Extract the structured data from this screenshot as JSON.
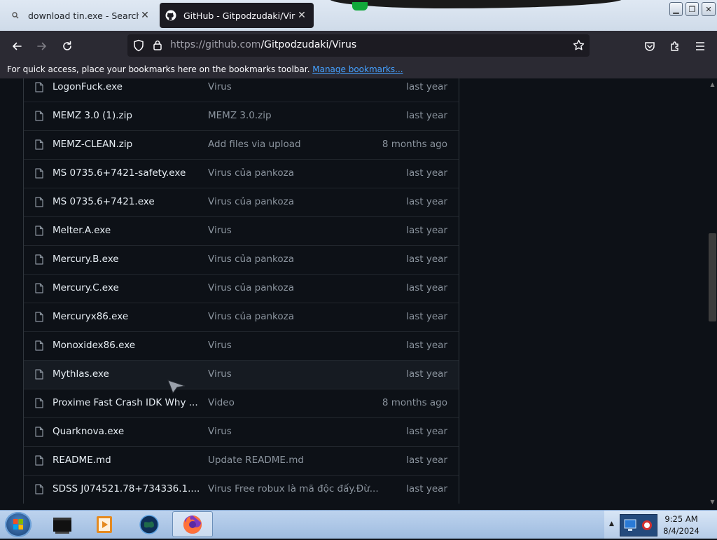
{
  "browser": {
    "tabs": [
      {
        "title": "download tin.exe - Search",
        "active": false
      },
      {
        "title": "GitHub - Gitpodzudaki/Virus",
        "active": true
      }
    ],
    "url_host": "https://github.com",
    "url_path": "/Gitpodzudaki/Virus",
    "bookmarks_message": "For quick access, place your bookmarks here on the bookmarks toolbar.",
    "bookmarks_link": "Manage bookmarks..."
  },
  "files": [
    {
      "name": "LogonFuck.exe",
      "message": "Virus",
      "age": "last year"
    },
    {
      "name": "MEMZ 3.0 (1).zip",
      "message": "MEMZ 3.0.zip",
      "age": "last year"
    },
    {
      "name": "MEMZ-CLEAN.zip",
      "message": "Add files via upload",
      "age": "8 months ago"
    },
    {
      "name": "MS 0735.6+7421-safety.exe",
      "message": "Virus của pankoza",
      "age": "last year"
    },
    {
      "name": "MS 0735.6+7421.exe",
      "message": "Virus của pankoza",
      "age": "last year"
    },
    {
      "name": "Melter.A.exe",
      "message": "Virus",
      "age": "last year"
    },
    {
      "name": "Mercury.B.exe",
      "message": "Virus của pankoza",
      "age": "last year"
    },
    {
      "name": "Mercury.C.exe",
      "message": "Virus của pankoza",
      "age": "last year"
    },
    {
      "name": "Mercuryx86.exe",
      "message": "Virus của pankoza",
      "age": "last year"
    },
    {
      "name": "Monoxidex86.exe",
      "message": "Virus",
      "age": "last year"
    },
    {
      "name": "Mythlas.exe",
      "message": "Virus",
      "age": "last year"
    },
    {
      "name": "Proxime Fast Crash IDK Why ...",
      "message": "Video",
      "age": "8 months ago"
    },
    {
      "name": "Quarknova.exe",
      "message": "Virus",
      "age": "last year"
    },
    {
      "name": "README.md",
      "message": "Update README.md",
      "age": "last year"
    },
    {
      "name": "SDSS J074521.78+734336.1....",
      "message": "Virus Free robux là mã độc đấy.Đừ...",
      "age": "last year"
    }
  ],
  "taskbar": {
    "time": "9:25 AM",
    "date": "8/4/2024"
  }
}
